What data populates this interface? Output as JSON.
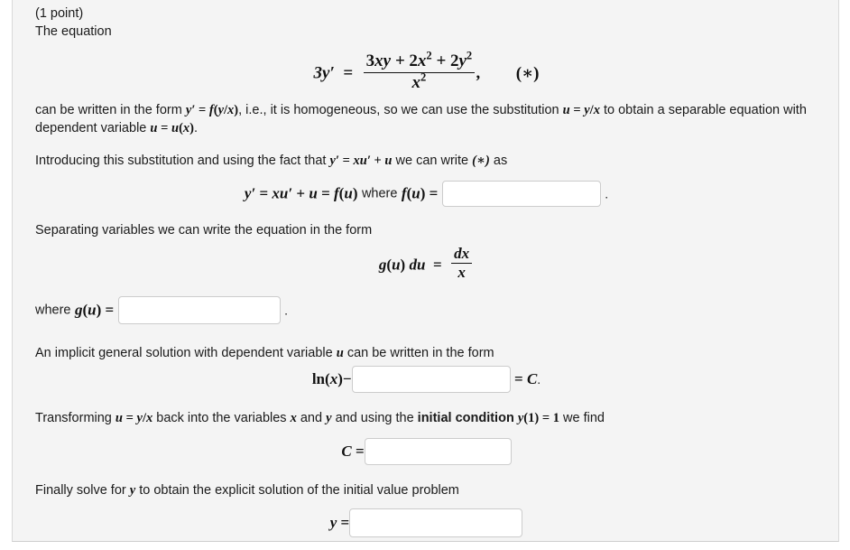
{
  "problem": {
    "points_label": "(1 point)",
    "intro_label": "The equation",
    "main_equation": {
      "lhs": "3y′",
      "eq": "=",
      "numerator": "3xy + 2x² + 2y²",
      "denominator": "x²",
      "comma": ",",
      "tag": "(∗)",
      "numer_parts": [
        "3",
        "x",
        "y",
        "+",
        "2",
        "x",
        "2",
        "+",
        "2",
        "y",
        "2"
      ],
      "denom_parts": [
        "x",
        "2"
      ]
    },
    "paragraph_homogeneous": {
      "p1": "can be written in the form",
      "m1": "y′ = f(y/x)",
      "p2": ", i.e., it is homogeneous, so we can use the substitution",
      "m2": "u = y/x",
      "p3": "to obtain a separable equation with dependent variable",
      "m3": "u = u(x)",
      "p4": "."
    },
    "paragraph_intro_sub": {
      "p1": "Introducing this substitution and using the fact that",
      "m1": "y′ = xu′ + u",
      "p2": "we can write",
      "m2": "(∗)",
      "p3": "as"
    },
    "row_fu": {
      "math_prefix": "y′ = xu′ + u = f(u)",
      "where_label": "where",
      "math_fu": "f(u) =",
      "input_value": "",
      "input_placeholder": "",
      "trailing_period": "."
    },
    "paragraph_separating": "Separating variables we can write the equation in the form",
    "equation_separated": {
      "lhs": "g(u) du",
      "eq": "=",
      "numerator": "dx",
      "denominator": "x"
    },
    "row_gu": {
      "where_label": "where",
      "math_gu": "g(u) =",
      "input_value": "",
      "input_placeholder": "",
      "trailing_period": "."
    },
    "paragraph_implicit": {
      "p1": "An implicit general solution with dependent variable",
      "m1": "u",
      "p2": "can be written in the form"
    },
    "row_ln": {
      "math_prefix": "ln(x)−",
      "input_value": "",
      "input_placeholder": "",
      "math_suffix": "= C",
      "trailing_period": "."
    },
    "paragraph_transform": {
      "p1": "Transforming",
      "m1": "u = y/x",
      "p2": "back into the variables",
      "m2": "x",
      "p3": "and",
      "m3": "y",
      "p4": "and using the",
      "bold1": "initial condition",
      "boldmath": "y(1) = 1",
      "p5": "we find"
    },
    "row_C": {
      "math_prefix": "C =",
      "input_value": "",
      "input_placeholder": ""
    },
    "paragraph_finally": {
      "p1": "Finally solve for",
      "m1": "y",
      "p2": "to obtain the explicit solution of the initial value problem"
    },
    "row_y": {
      "math_prefix": "y =",
      "input_value": "",
      "input_placeholder": ""
    }
  },
  "theme": {
    "panel_background": "#f4f4f4",
    "page_background": "#ffffff",
    "border_color": "#d9d9d9",
    "text_color": "#1a1a1a",
    "math_color": "#111111",
    "input_border": "#cccccc",
    "input_background": "#ffffff"
  }
}
